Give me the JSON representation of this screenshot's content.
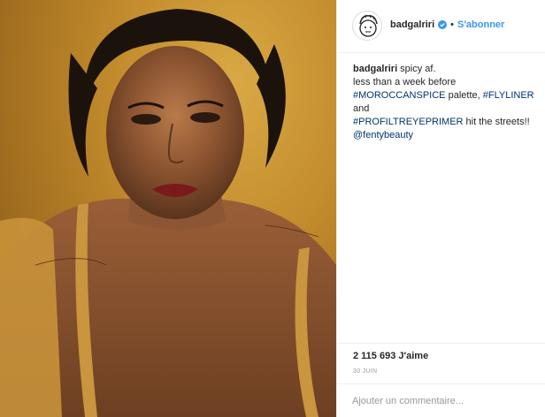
{
  "post": {
    "image_alt": "photo",
    "header": {
      "username": "badgalriri",
      "separator": "•",
      "follow_label": "S'abonner"
    },
    "caption": {
      "username": "badgalriri",
      "line1_text": " spicy af.",
      "line2_text": "less than a week before",
      "tag1": "#MOROCCANSPICE",
      "line3_mid": " palette, ",
      "tag2": "#FLYLINER",
      "line3_end": " and",
      "tag3": "#PROFILTREYEPRIMER",
      "line4_end": " hit the streets!!",
      "mention": "@fentybeauty"
    },
    "likes": "2 115 693 J'aime",
    "date": "30 JUIN",
    "comment_placeholder": "Ajouter un commentaire..."
  },
  "colors": {
    "link_blue": "#3897f0",
    "tag_blue": "#003569",
    "text": "#262626",
    "muted": "#999999",
    "verified": "#3897f0"
  },
  "icons": {
    "verified": "verified-badge-icon",
    "avatar": "avatar-sketch-icon"
  }
}
